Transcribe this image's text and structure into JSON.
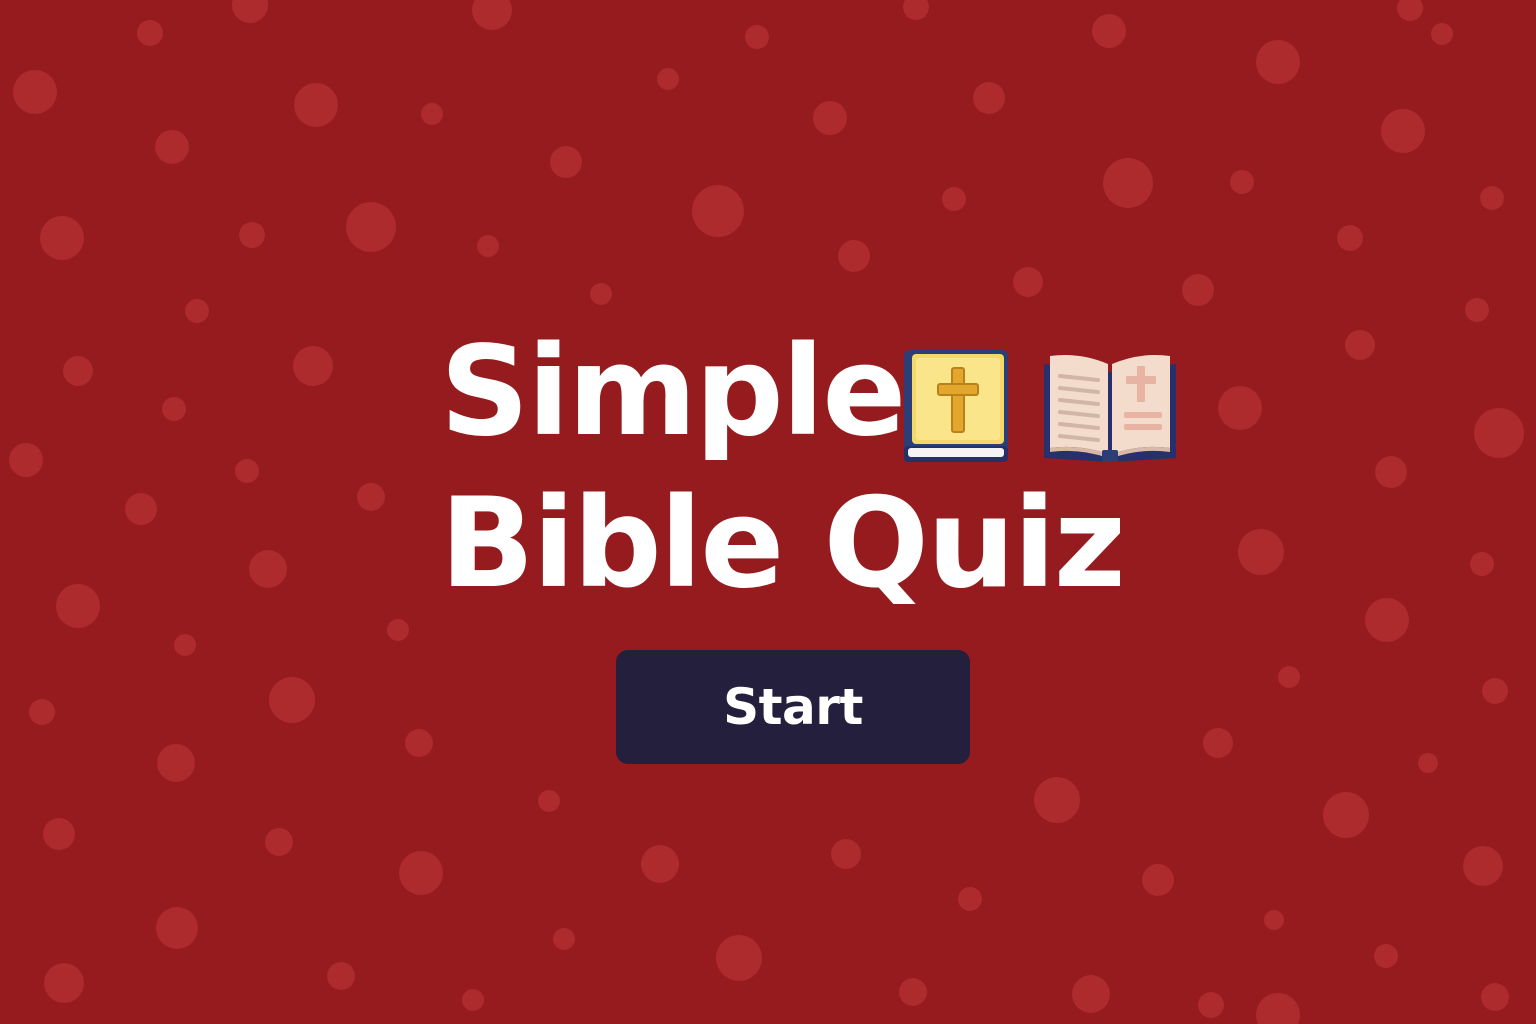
{
  "colors": {
    "background": "#961b1e",
    "dot": "#ad2a2d",
    "button_background": "#241f3c",
    "text": "#ffffff"
  },
  "title": {
    "line1": "Simple",
    "line2": "Bible Quiz",
    "icons": [
      "closed-bible-with-cross-icon",
      "open-bible-icon"
    ]
  },
  "start_button": {
    "label": "Start"
  }
}
